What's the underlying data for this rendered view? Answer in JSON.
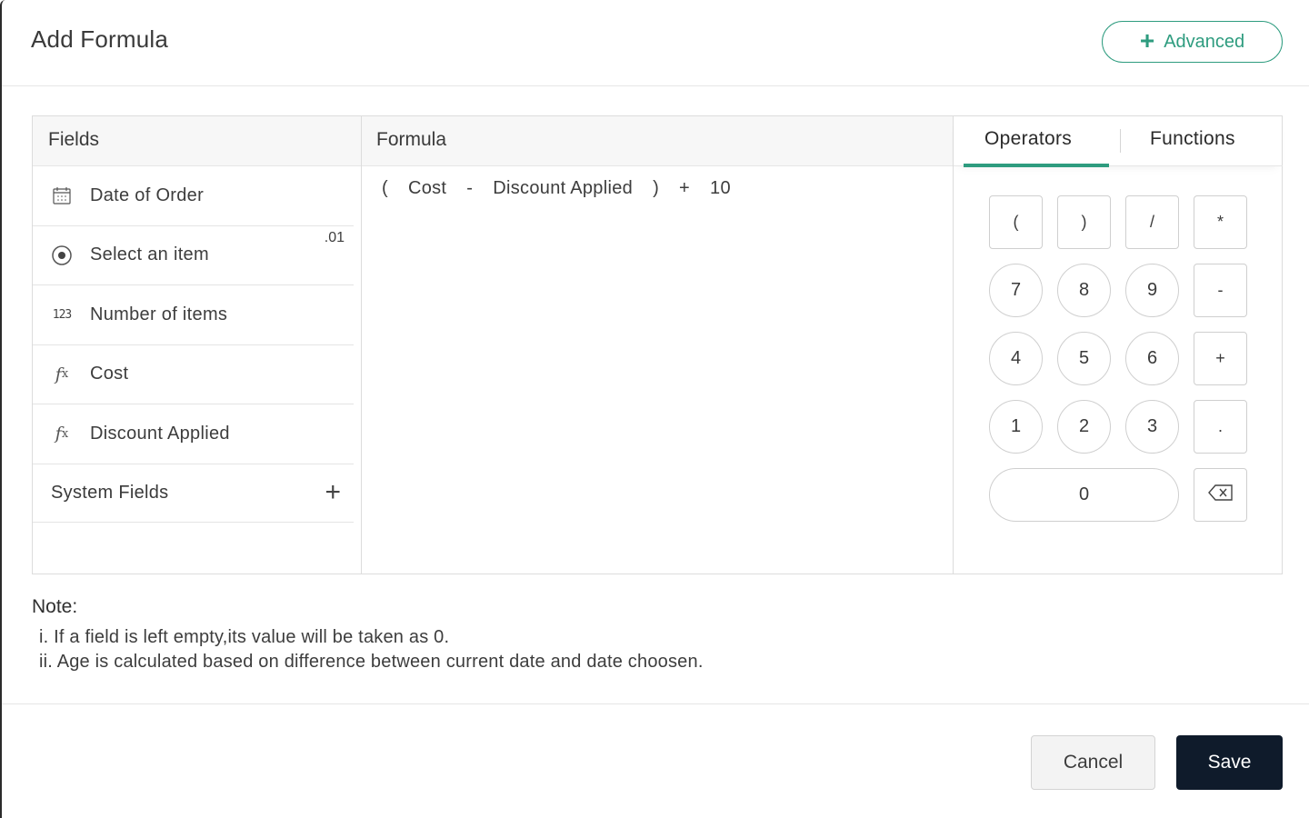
{
  "dialog": {
    "title": "Add Formula",
    "advanced_button": {
      "icon": "plus-icon",
      "label": "Advanced"
    }
  },
  "accent_color": "#2e9c7f",
  "fields_panel": {
    "header": "Fields",
    "items": [
      {
        "icon": "calendar-icon",
        "label": "Date of Order",
        "badge": ""
      },
      {
        "icon": "radio-icon",
        "label": "Select an item",
        "badge": ".01"
      },
      {
        "icon": "number-icon",
        "label": "Number of items",
        "badge": ""
      },
      {
        "icon": "function-icon",
        "label": "Cost",
        "badge": ""
      },
      {
        "icon": "function-icon",
        "label": "Discount Applied",
        "badge": ""
      }
    ],
    "system_fields": {
      "label": "System Fields",
      "icon": "plus-icon"
    }
  },
  "formula_panel": {
    "header": "Formula",
    "tokens": [
      "(",
      "Cost",
      "-",
      "Discount Applied",
      ")",
      "+",
      "10"
    ]
  },
  "operators_panel": {
    "tabs": [
      {
        "label": "Operators",
        "active": true
      },
      {
        "label": "Functions",
        "active": false
      }
    ],
    "keys": [
      "(",
      ")",
      "/",
      "*",
      "7",
      "8",
      "9",
      "-",
      "4",
      "5",
      "6",
      "+",
      "1",
      "2",
      "3",
      ".",
      "0",
      "backspace-icon"
    ]
  },
  "note": {
    "title": "Note:",
    "lines": [
      "i. If a field is left empty,its value will be taken as 0.",
      "ii. Age is calculated based on difference between current date and date choosen."
    ]
  },
  "footer": {
    "cancel_label": "Cancel",
    "save_label": "Save"
  }
}
